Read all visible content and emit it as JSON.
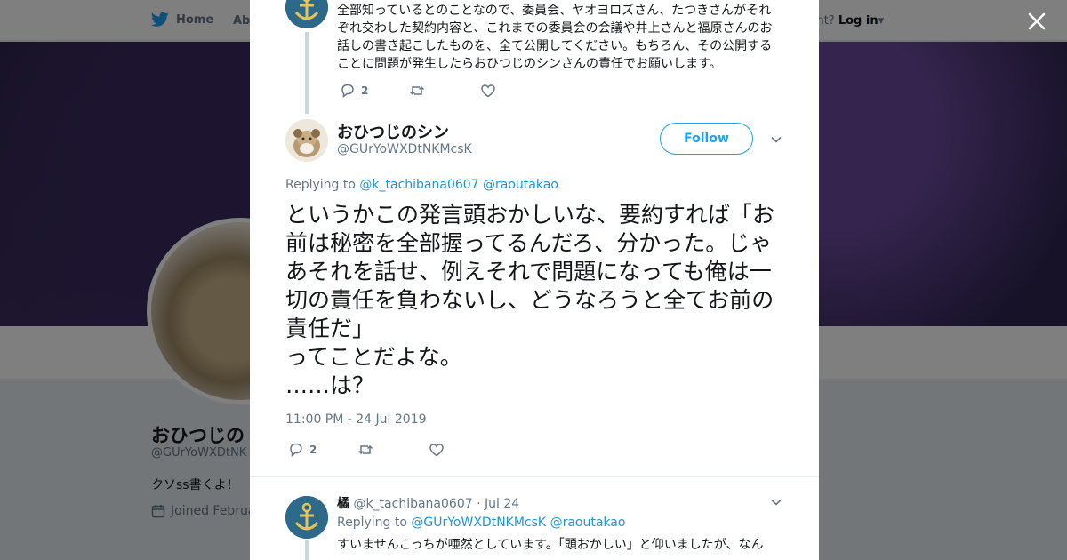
{
  "nav": {
    "home": "Home",
    "about": "Abo",
    "login_prompt": "account?",
    "login": "Log in"
  },
  "profile": {
    "name": "おひつじの",
    "handle": "@GUrYoWXDtNK",
    "bio": "クソss書くよ！",
    "joined": "Joined Februa"
  },
  "parent_tweet": {
    "text": "全部知っているとのことなので、委員会、ヤオヨロズさん、たつきさんがそれぞれ交わした契約内容と、これまでの委員会の会議や井上さんと福原さんのお話しの書き起こしたものを、全て公開してください。もちろん、その公開することに問題が発生したらおひつじのシンさんの責任でお願いします。",
    "reply_count": "2"
  },
  "main_tweet": {
    "name": "おひつじのシン",
    "handle": "@GUrYoWXDtNKMcsK",
    "follow_label": "Follow",
    "replying_prefix": "Replying to",
    "replying_to_1": "@k_tachibana0607",
    "replying_to_2": "@raoutakao",
    "text": "というかこの発言頭おかしいな、要約すれば「お前は秘密を全部握ってるんだろ、分かった。じゃあそれを話せ、例えそれで問題になっても俺は一切の責任を負わないし、どうなろうと全てお前の責任だ」\nってことだよな。\n……は？",
    "timestamp": "11:00 PM - 24 Jul 2019",
    "reply_count": "2"
  },
  "reply_tweet": {
    "name": "橘",
    "handle": "@k_tachibana0607",
    "date": "· Jul 24",
    "replying_prefix": "Replying to",
    "replying_to_1": "@GUrYoWXDtNKMcsK",
    "replying_to_2": "@raoutakao",
    "text": "すいませんこっちが唖然としています。「頭おかしい」と仰いましたが、なん"
  },
  "colors": {
    "accent": "#1da1f2",
    "link": "#1b95e0",
    "muted": "#657786"
  },
  "icons": [
    "twitter-bird-icon",
    "close-icon",
    "reply-icon",
    "retweet-icon",
    "like-icon",
    "chevron-down-icon",
    "calendar-icon"
  ]
}
